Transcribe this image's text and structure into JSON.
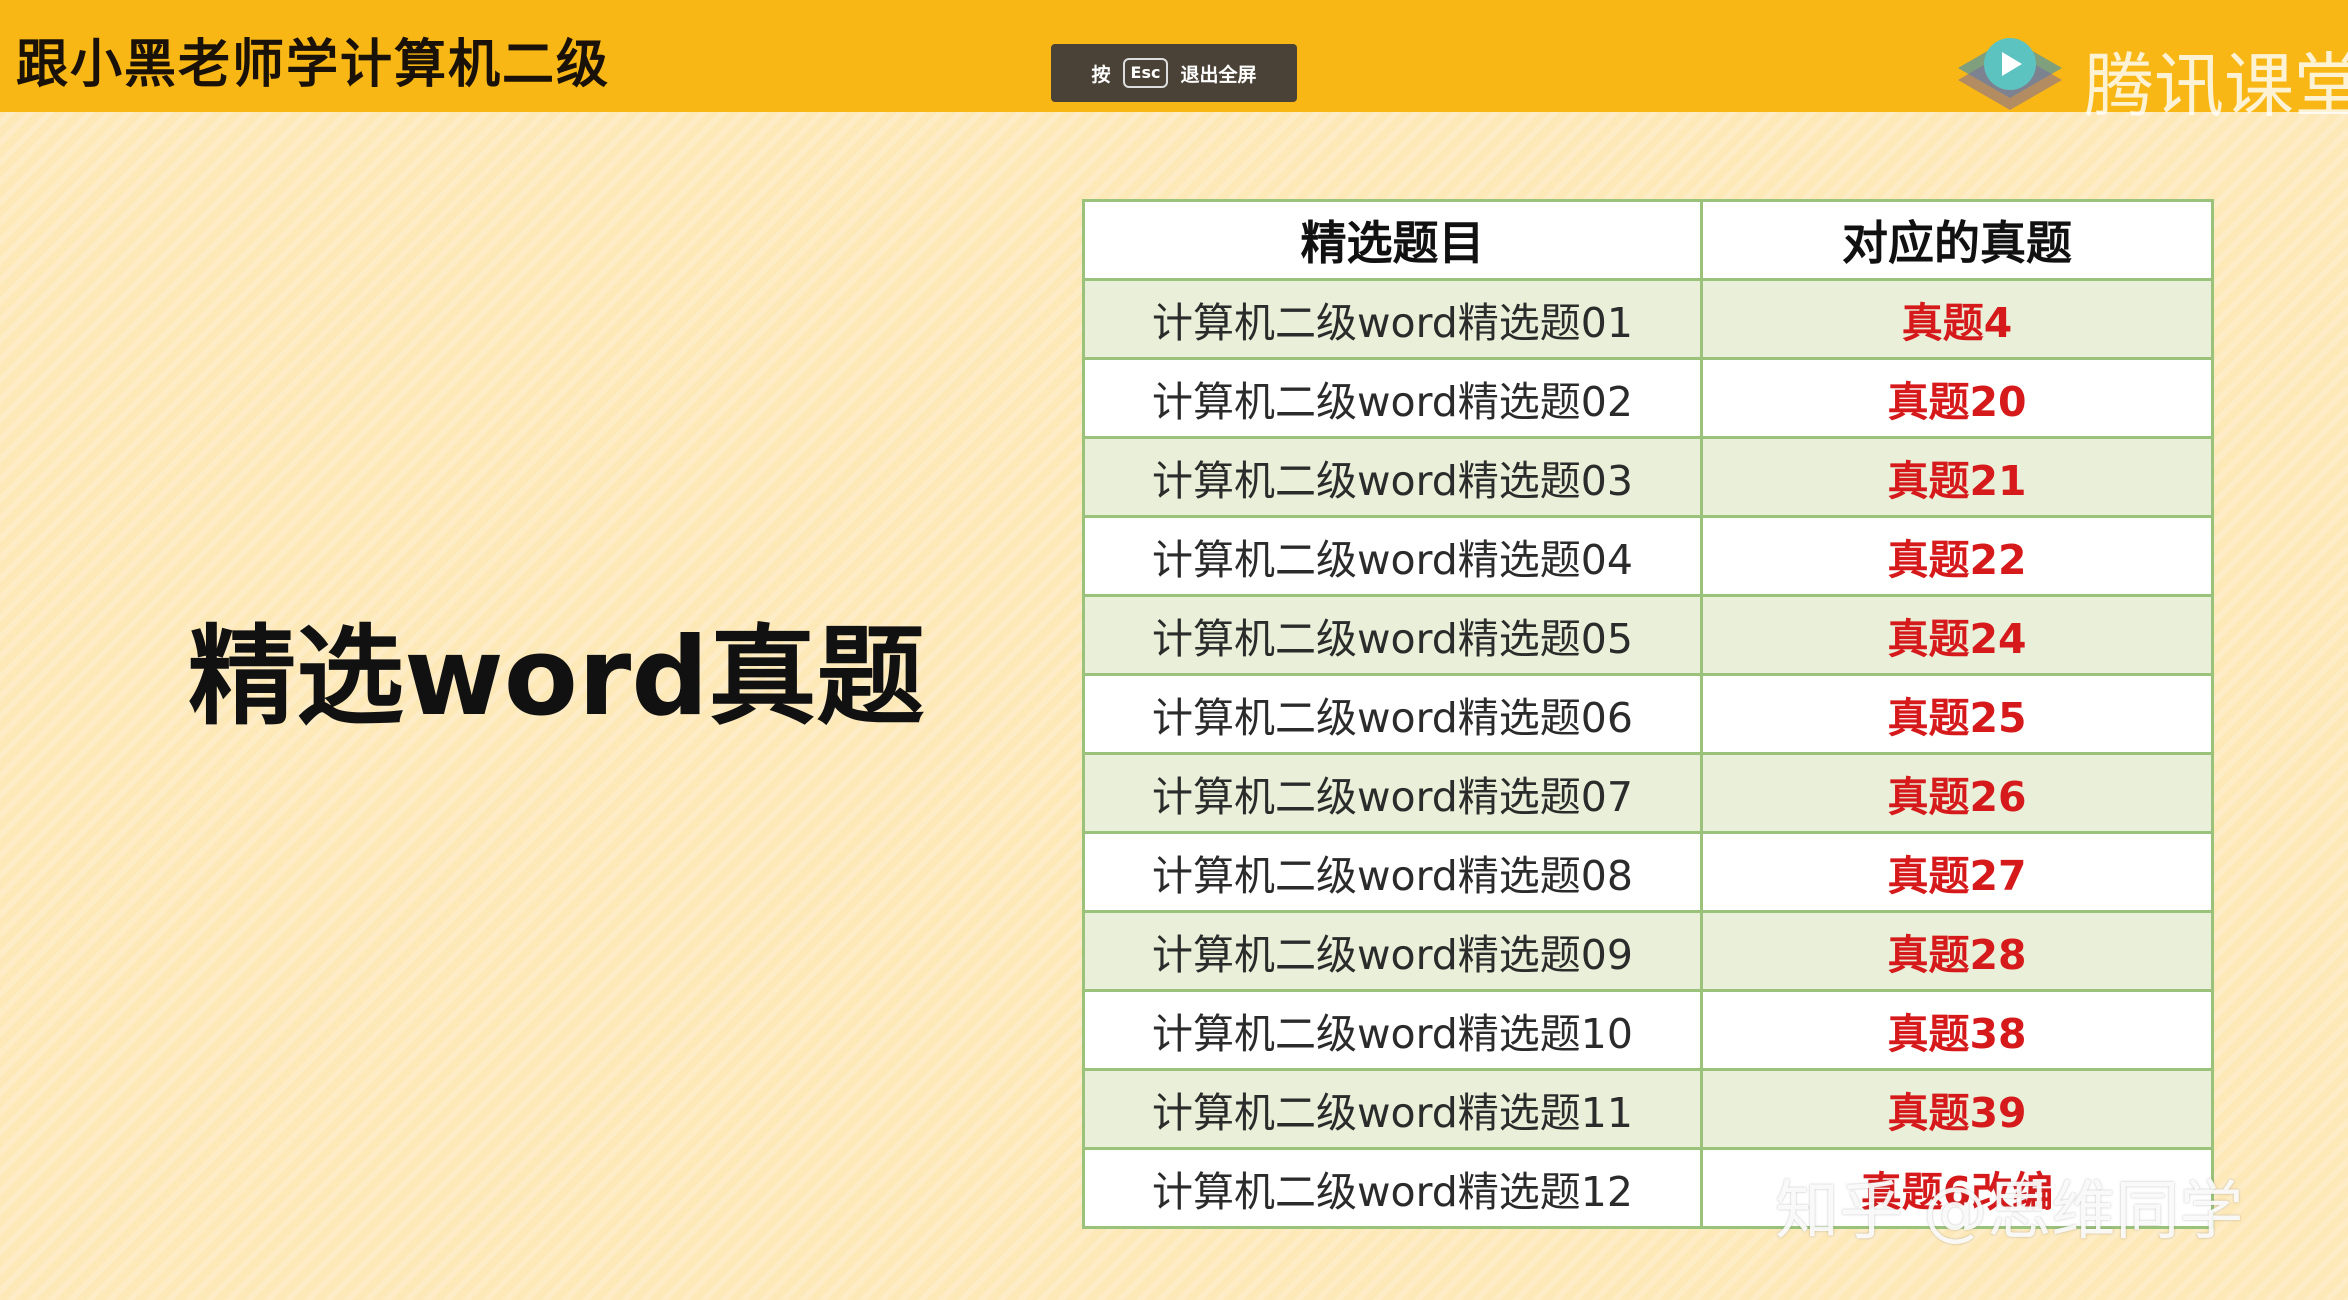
{
  "header": {
    "course_title": "跟小黑老师学计算机二级",
    "esc_tip": {
      "press": "按",
      "key": "Esc",
      "action": "退出全屏"
    },
    "brand_name": "腾讯课堂"
  },
  "slide": {
    "heading": "精选word真题",
    "table": {
      "headers": [
        "精选题目",
        "对应的真题"
      ],
      "rows": [
        {
          "question": "计算机二级word精选题01",
          "answer": "真题4"
        },
        {
          "question": "计算机二级word精选题02",
          "answer": "真题20"
        },
        {
          "question": "计算机二级word精选题03",
          "answer": "真题21"
        },
        {
          "question": "计算机二级word精选题04",
          "answer": "真题22"
        },
        {
          "question": "计算机二级word精选题05",
          "answer": "真题24"
        },
        {
          "question": "计算机二级word精选题06",
          "answer": "真题25"
        },
        {
          "question": "计算机二级word精选题07",
          "answer": "真题26"
        },
        {
          "question": "计算机二级word精选题08",
          "answer": "真题27"
        },
        {
          "question": "计算机二级word精选题09",
          "answer": "真题28"
        },
        {
          "question": "计算机二级word精选题10",
          "answer": "真题38"
        },
        {
          "question": "计算机二级word精选题11",
          "answer": "真题39"
        },
        {
          "question": "计算机二级word精选题12",
          "answer": "真题6改编"
        }
      ]
    }
  },
  "watermark": "知乎 @思维同学",
  "colors": {
    "header_bg": "#f8b714",
    "slide_bg": "#fde8b8",
    "answer_red": "#d6191b",
    "table_border": "#9ac27a",
    "row_alt": "#e9efd8"
  }
}
